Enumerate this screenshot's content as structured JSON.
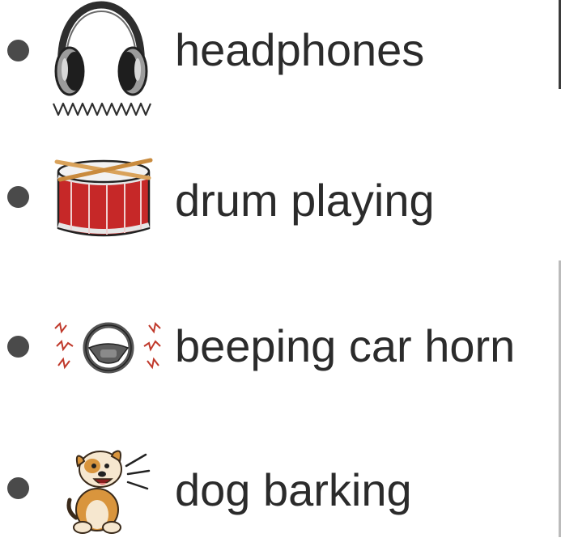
{
  "items": [
    {
      "label": "headphones",
      "icon": "headphones-icon",
      "bullet_color": "#4a4a4a"
    },
    {
      "label": "drum playing",
      "icon": "drum-icon",
      "bullet_color": "#4a4a4a"
    },
    {
      "label": "beeping car horn",
      "icon": "car-horn-icon",
      "bullet_color": "#4a4a4a"
    },
    {
      "label": "dog barking",
      "icon": "barking-dog-icon",
      "bullet_color": "#4a4a4a"
    }
  ],
  "colors": {
    "text": "#2b2b2b",
    "drum_red": "#c62828",
    "horn_red": "#c0392b",
    "dog_orange": "#d9953d"
  }
}
